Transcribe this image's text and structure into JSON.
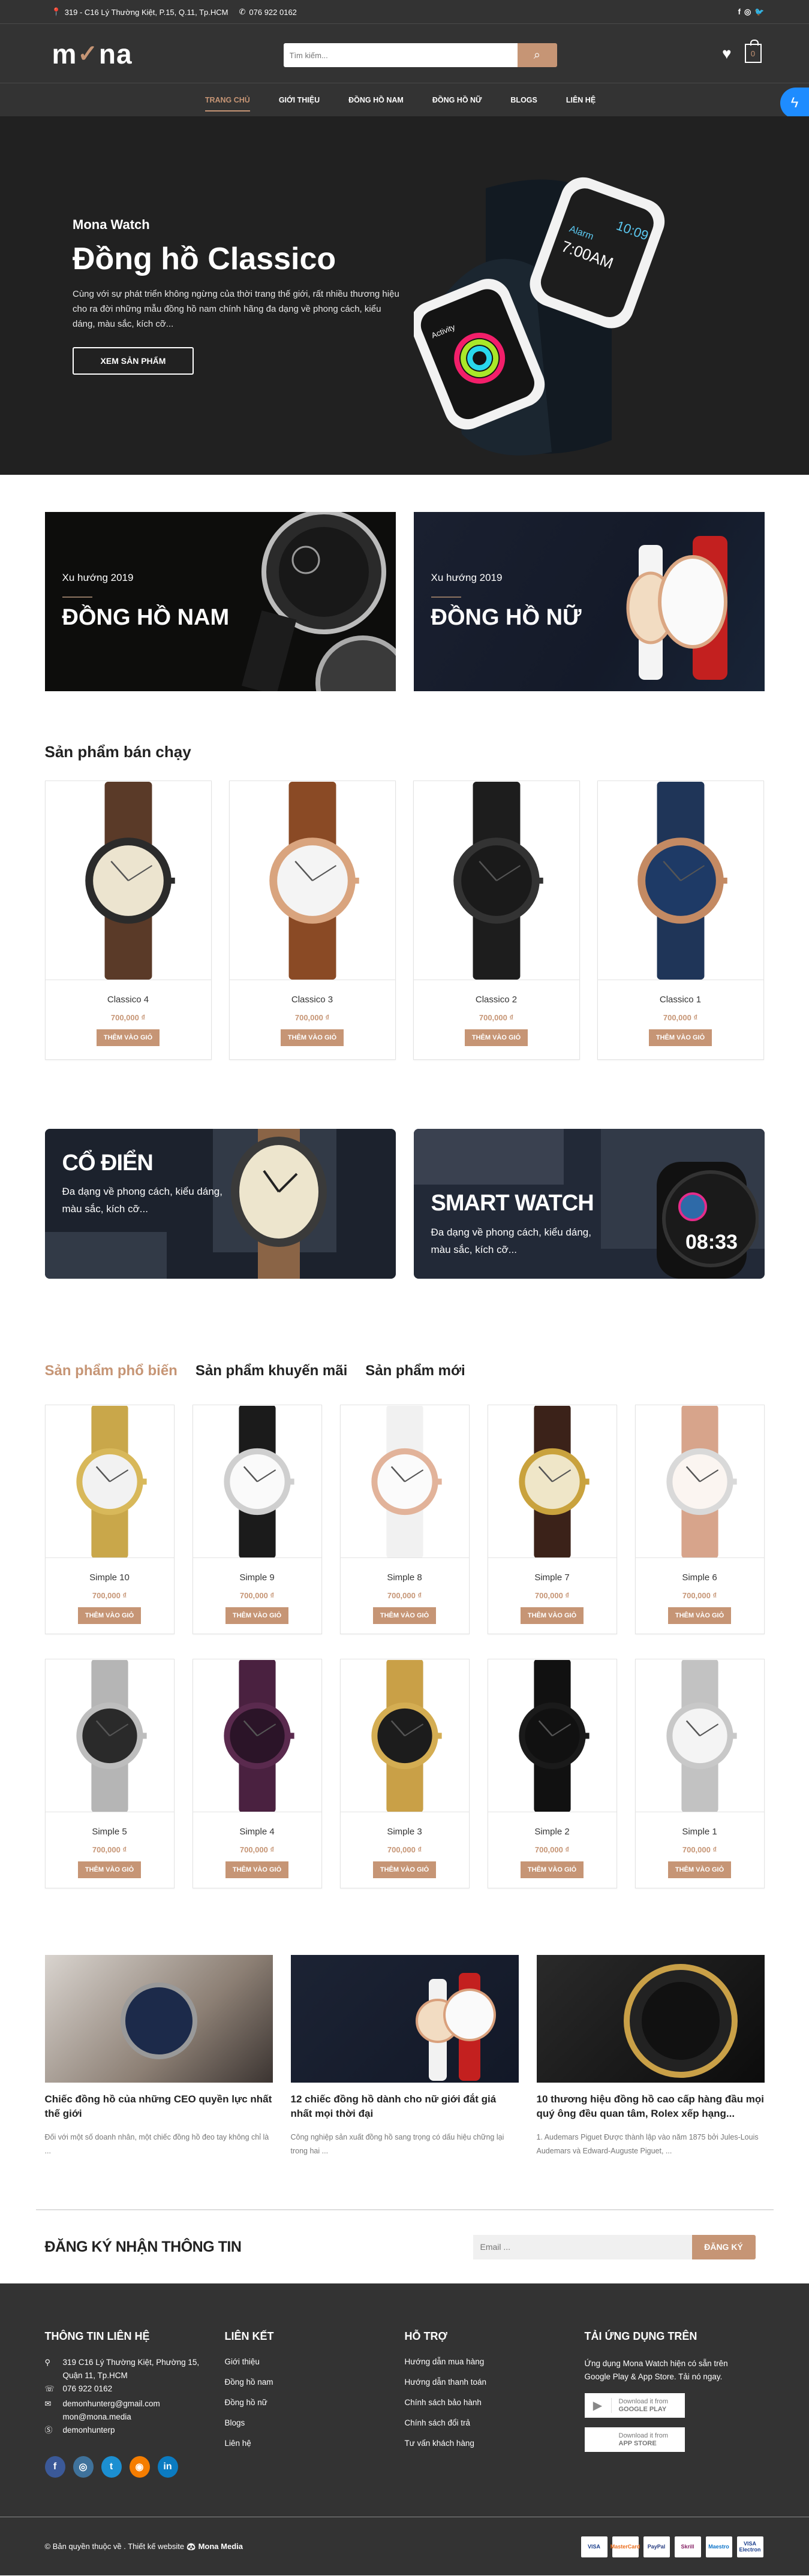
{
  "topbar": {
    "address": "319 - C16 Lý Thường Kiệt, P.15, Q.11, Tp.HCM",
    "phone": "076 922 0162",
    "social": [
      {
        "icon": "facebook-icon",
        "glyph": "f"
      },
      {
        "icon": "instagram-icon",
        "glyph": "◎"
      },
      {
        "icon": "twitter-icon",
        "glyph": "🐦"
      }
    ]
  },
  "header": {
    "logo": {
      "m": "m",
      "o": "✓",
      "na": "na"
    },
    "search_placeholder": "Tìm kiếm...",
    "cart_count": "0"
  },
  "nav": {
    "items": [
      {
        "label": "TRANG CHỦ",
        "active": true
      },
      {
        "label": "GIỚI THIỆU"
      },
      {
        "label": "ĐỒNG HỒ NAM"
      },
      {
        "label": "ĐỒNG HỒ NỮ"
      },
      {
        "label": "BLOGS"
      },
      {
        "label": "LIÊN HỆ"
      }
    ]
  },
  "hero": {
    "eyebrow": "Mona Watch",
    "title": "Đồng hồ Classico",
    "description": "Cùng với sự phát triển không ngừng của thời trang thế giới, rất nhiều thương hiệu cho ra đời những mẫu đồng hồ nam chính hãng đa dạng về phong cách, kiểu dáng, màu sắc, kích cỡ...",
    "button": "XEM SẢN PHẨM",
    "watch_screens": {
      "time": "10:09",
      "alarm_label": "Alarm",
      "alarm_time": "7:00AM",
      "activity_label": "Activity"
    }
  },
  "category_banners": [
    {
      "eyebrow": "Xu hướng 2019",
      "title": "ĐỒNG HỒ NAM"
    },
    {
      "eyebrow": "Xu hướng 2019",
      "title": "ĐỒNG HỒ NỮ"
    }
  ],
  "best_sellers": {
    "heading": "Sản phẩm bán chạy",
    "add_to_cart": "THÊM VÀO GIỎ",
    "products": [
      {
        "name": "Classico 4",
        "price": "700,000 ₫",
        "colors": {
          "strap": "#5a3a28",
          "case": "#2b2b2b",
          "dial": "#ece4cf"
        }
      },
      {
        "name": "Classico 3",
        "price": "700,000 ₫",
        "colors": {
          "strap": "#8a4a25",
          "case": "#d9a47e",
          "dial": "#f4f4f4"
        }
      },
      {
        "name": "Classico 2",
        "price": "700,000 ₫",
        "colors": {
          "strap": "#1d1d1d",
          "case": "#333",
          "dial": "#1a1a1a"
        }
      },
      {
        "name": "Classico 1",
        "price": "700,000 ₫",
        "colors": {
          "strap": "#1f3558",
          "case": "#c48a63",
          "dial": "#1e3a66"
        }
      }
    ]
  },
  "promo_banners": [
    {
      "title": "CỔ ĐIỂN",
      "description": "Đa dạng về phong cách, kiểu dáng, màu sắc, kích cỡ..."
    },
    {
      "title": "SMART WATCH",
      "description": "Đa dạng về phong cách, kiểu dáng, màu sắc, kích cỡ...",
      "screen_time": "08:33"
    }
  ],
  "product_tabs": {
    "tabs": [
      {
        "label": "Sản phẩm phổ biến",
        "active": true
      },
      {
        "label": "Sản phẩm khuyến mãi"
      },
      {
        "label": "Sản phẩm mới"
      }
    ],
    "add_to_cart": "THÊM VÀO GIỎ",
    "products": [
      {
        "name": "Simple 10",
        "price": "700,000 ₫",
        "colors": {
          "strap": "#c9a74a",
          "case": "#d8b85a",
          "dial": "#f2f2f2"
        }
      },
      {
        "name": "Simple 9",
        "price": "700,000 ₫",
        "colors": {
          "strap": "#1b1b1b",
          "case": "#cfcfcf",
          "dial": "#fafafa"
        }
      },
      {
        "name": "Simple 8",
        "price": "700,000 ₫",
        "colors": {
          "strap": "#f1f1f1",
          "case": "#e2b39a",
          "dial": "#fbfbfb"
        }
      },
      {
        "name": "Simple 7",
        "price": "700,000 ₫",
        "colors": {
          "strap": "#3b2219",
          "case": "#c9a23d",
          "dial": "#efe6c8"
        }
      },
      {
        "name": "Simple 6",
        "price": "700,000 ₫",
        "colors": {
          "strap": "#d7a48b",
          "case": "#d9d9d9",
          "dial": "#fbf5f1"
        }
      },
      {
        "name": "Simple 5",
        "price": "700,000 ₫",
        "colors": {
          "strap": "#b5b5b5",
          "case": "#bdbdbd",
          "dial": "#2a2a2a"
        }
      },
      {
        "name": "Simple 4",
        "price": "700,000 ₫",
        "colors": {
          "strap": "#4a2140",
          "case": "#5a2a4e",
          "dial": "#2b1428"
        }
      },
      {
        "name": "Simple 3",
        "price": "700,000 ₫",
        "colors": {
          "strap": "#c9a047",
          "case": "#d4ad52",
          "dial": "#1c1c1c"
        }
      },
      {
        "name": "Simple 2",
        "price": "700,000 ₫",
        "colors": {
          "strap": "#111",
          "case": "#1a1a1a",
          "dial": "#111"
        }
      },
      {
        "name": "Simple 1",
        "price": "700,000 ₫",
        "colors": {
          "strap": "#c2c2c2",
          "case": "#c8c8c8",
          "dial": "#f4f4f4"
        }
      }
    ]
  },
  "blogs": [
    {
      "title": "Chiếc đồng hồ của những CEO quyền lực nhất thế giới",
      "excerpt": "Đối với một số doanh nhân, một chiếc đồng hồ đeo tay không chỉ là ..."
    },
    {
      "title": "12 chiếc đồng hồ dành cho nữ giới đắt giá nhất mọi thời đại",
      "excerpt": "Công nghiệp sản xuất đồng hồ sang trọng có dấu hiệu chững lại trong hai ..."
    },
    {
      "title": "10 thương hiệu đồng hồ cao cấp hàng đầu mọi quý ông đều quan tâm, Rolex xếp hạng...",
      "excerpt": "1. Audemars Piguet Được thành lập vào năm 1875 bởi Jules-Louis Audemars và Edward-Auguste Piguet, ..."
    }
  ],
  "newsletter": {
    "title": "ĐĂNG KÝ NHẬN THÔNG TIN",
    "placeholder": "Email ...",
    "button": "ĐĂNG KÝ"
  },
  "footer": {
    "contact": {
      "heading": "THÔNG TIN LIÊN HỆ",
      "address": [
        "319 C16 Lý Thường Kiệt, Phường 15,",
        "Quận 11, Tp.HCM"
      ],
      "phone": "076 922 0162",
      "emails": [
        "demonhunterg@gmail.com",
        "mon@mona.media"
      ],
      "skype": "demonhunterp",
      "socials": [
        {
          "icon": "facebook-icon",
          "glyph": "f",
          "color": "#3b5998"
        },
        {
          "icon": "instagram-icon",
          "glyph": "◎",
          "color": "#3f729b"
        },
        {
          "icon": "twitter-icon",
          "glyph": "t",
          "color": "#1c8fd1"
        },
        {
          "icon": "rss-icon",
          "glyph": "◉",
          "color": "#f57d00"
        },
        {
          "icon": "linkedin-icon",
          "glyph": "in",
          "color": "#0b7bc1"
        }
      ]
    },
    "links": {
      "heading": "LIÊN KẾT",
      "items": [
        "Giới thiệu",
        "Đồng hồ nam",
        "Đồng hồ nữ",
        "Blogs",
        "Liên hệ"
      ]
    },
    "support": {
      "heading": "HỖ TRỢ",
      "items": [
        "Hướng dẫn mua hàng",
        "Hướng dẫn thanh toán",
        "Chính sách bảo hành",
        "Chính sách đổi trả",
        "Tư vấn khách hàng"
      ]
    },
    "app": {
      "heading": "TẢI ỨNG DỤNG TRÊN",
      "text": "Ứng dụng Mona Watch hiện có sẵn trên Google Play & App Store. Tải nó ngay.",
      "badges": [
        {
          "icon": "google-play-icon",
          "glyph": "▶",
          "line1": "Download it from",
          "line2": "GOOGLE PLAY"
        },
        {
          "icon": "apple-icon",
          "glyph": "",
          "line1": "Download it from",
          "line2": "APP STORE"
        }
      ]
    },
    "copyright": "© Bản quyền thuộc về . Thiết kế website",
    "brand": "Mona Media",
    "payments": [
      {
        "label": "VISA",
        "color": "#1a3e8c"
      },
      {
        "label": "MasterCard",
        "color": "#eb6c1b"
      },
      {
        "label": "PayPal",
        "color": "#253b80"
      },
      {
        "label": "Skrill",
        "color": "#862165"
      },
      {
        "label": "Maestro",
        "color": "#0a73c9"
      },
      {
        "label": "VISA Electron",
        "color": "#1a3e8c"
      }
    ]
  }
}
